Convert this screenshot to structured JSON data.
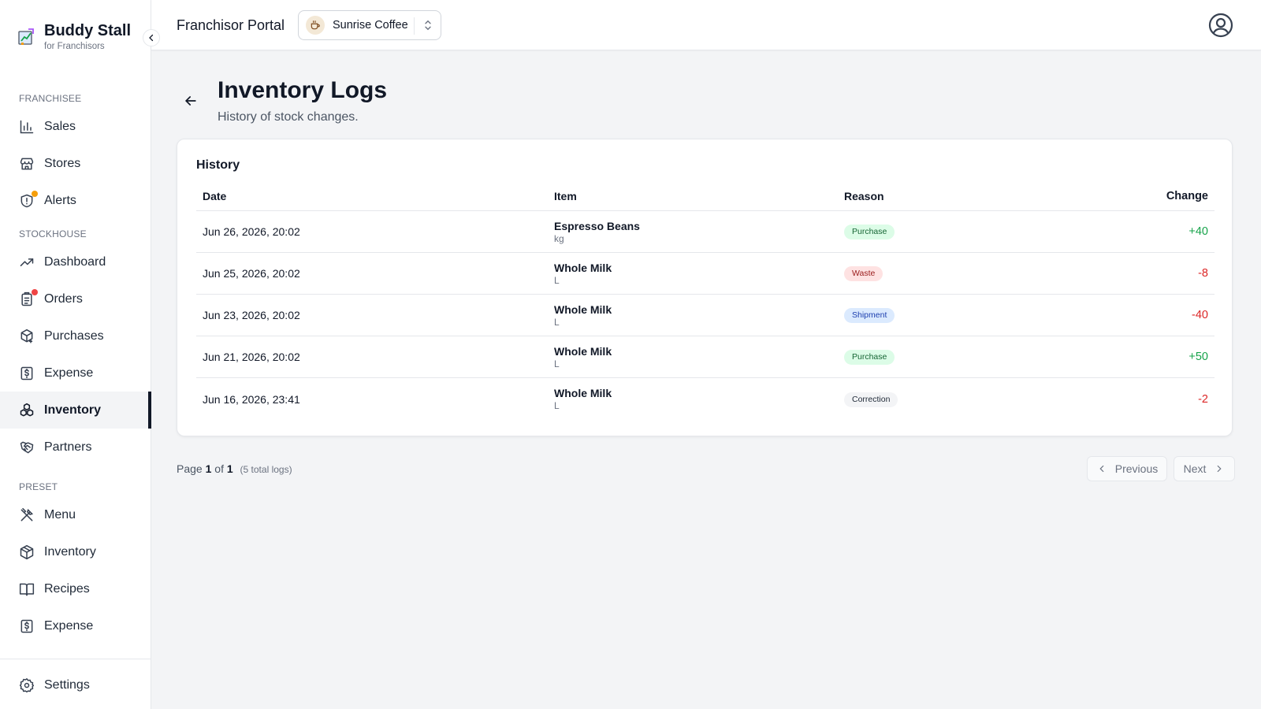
{
  "brand": {
    "name": "Buddy Stall",
    "subtitle": "for Franchisors"
  },
  "sidebar": {
    "sections": [
      {
        "label": "FRANCHISEE"
      },
      {
        "label": "STOCKHOUSE"
      },
      {
        "label": "PRESET"
      }
    ],
    "items": [
      {
        "label": "Sales",
        "icon": "bar-chart-icon"
      },
      {
        "label": "Stores",
        "icon": "store-icon"
      },
      {
        "label": "Alerts",
        "icon": "shield-alert-icon",
        "badge_color": "#f59e0b"
      },
      {
        "label": "Dashboard",
        "icon": "trending-up-icon"
      },
      {
        "label": "Orders",
        "icon": "clipboard-list-icon",
        "badge_color": "#ef4444"
      },
      {
        "label": "Purchases",
        "icon": "package-plus-icon"
      },
      {
        "label": "Expense",
        "icon": "receipt-dollar-icon"
      },
      {
        "label": "Inventory",
        "icon": "boxes-icon",
        "active": true
      },
      {
        "label": "Partners",
        "icon": "handshake-icon"
      },
      {
        "label": "Menu",
        "icon": "utensils-crossed-icon"
      },
      {
        "label": "Inventory",
        "icon": "package-icon"
      },
      {
        "label": "Recipes",
        "icon": "book-open-icon"
      },
      {
        "label": "Expense",
        "icon": "receipt-dollar-icon"
      },
      {
        "label": "Settings",
        "icon": "gear-icon"
      }
    ]
  },
  "header": {
    "portal_title": "Franchisor Portal",
    "store": {
      "name": "Sunrise Coffee",
      "avatar_icon": "coffee-icon"
    }
  },
  "page": {
    "title": "Inventory Logs",
    "subtitle": "History of stock changes."
  },
  "history": {
    "title": "History",
    "columns": {
      "date": "Date",
      "item": "Item",
      "reason": "Reason",
      "change": "Change"
    },
    "rows": [
      {
        "date": "Jun 26, 2026, 20:02",
        "item": "Espresso Beans",
        "unit": "kg",
        "reason": "Purchase",
        "change": "+40"
      },
      {
        "date": "Jun 25, 2026, 20:02",
        "item": "Whole Milk",
        "unit": "L",
        "reason": "Waste",
        "change": "-8"
      },
      {
        "date": "Jun 23, 2026, 20:02",
        "item": "Whole Milk",
        "unit": "L",
        "reason": "Shipment",
        "change": "-40"
      },
      {
        "date": "Jun 21, 2026, 20:02",
        "item": "Whole Milk",
        "unit": "L",
        "reason": "Purchase",
        "change": "+50"
      },
      {
        "date": "Jun 16, 2026, 23:41",
        "item": "Whole Milk",
        "unit": "L",
        "reason": "Correction",
        "change": "-2"
      }
    ]
  },
  "badge_styles": {
    "Purchase": {
      "bg": "#dcfce7",
      "fg": "#166534"
    },
    "Waste": {
      "bg": "#fee2e2",
      "fg": "#991b1b"
    },
    "Shipment": {
      "bg": "#dbeafe",
      "fg": "#1e40af"
    },
    "Correction": {
      "bg": "#f3f4f6",
      "fg": "#1f2937"
    }
  },
  "colors": {
    "positive": "#16a34a",
    "negative": "#dc2626",
    "active_indicator": "#111827"
  },
  "pagination": {
    "page_word": "Page",
    "current": "1",
    "of_word": "of",
    "total_pages": "1",
    "total_text": "(5 total logs)",
    "previous": "Previous",
    "next": "Next"
  }
}
